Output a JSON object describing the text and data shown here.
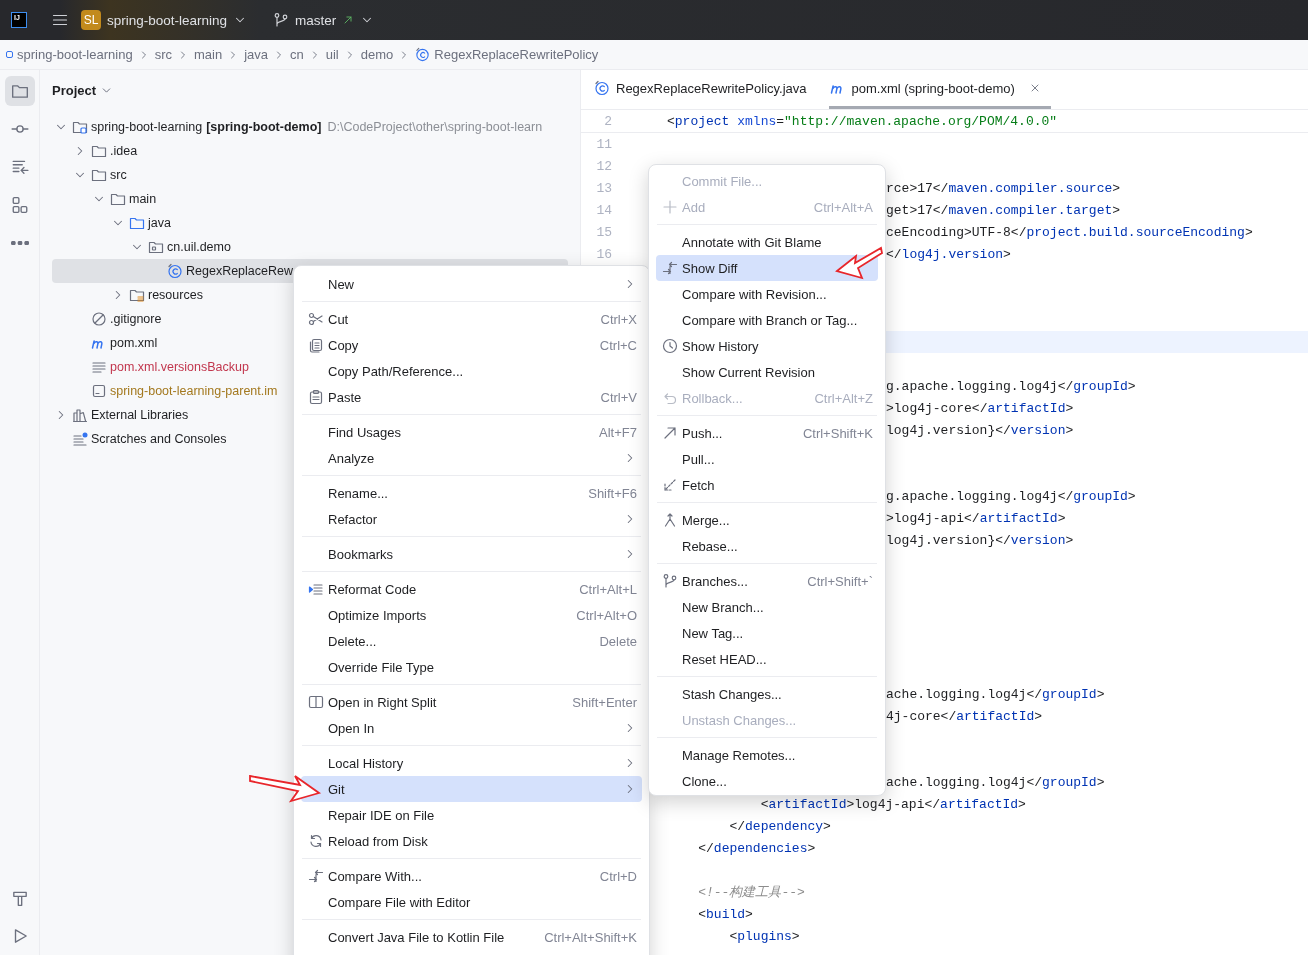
{
  "title_bar": {
    "logo": "IJ",
    "project_badge": "SL",
    "project": "spring-boot-learning",
    "branch": "master"
  },
  "breadcrumbs": [
    {
      "label": "spring-boot-learning",
      "kind": "module"
    },
    {
      "label": "src"
    },
    {
      "label": "main"
    },
    {
      "label": "java"
    },
    {
      "label": "cn"
    },
    {
      "label": "uil"
    },
    {
      "label": "demo"
    },
    {
      "label": "RegexReplaceRewritePolicy",
      "kind": "class"
    }
  ],
  "tool_strip": [
    {
      "kind": "folder",
      "selected": true
    },
    {
      "kind": "commit",
      "selected": false
    },
    {
      "kind": "pull",
      "selected": false
    },
    {
      "kind": "structure",
      "selected": false
    },
    {
      "kind": "more",
      "selected": false
    }
  ],
  "tool_strip_bottom": [
    {
      "kind": "build",
      "selected": false
    },
    {
      "kind": "run",
      "selected": false
    }
  ],
  "project_panel": {
    "title": "Project",
    "tree": [
      {
        "label": "spring-boot-learning",
        "module": "[spring-boot-demo]",
        "path": "D:\\CodeProject\\other\\spring-boot-learn",
        "kind": "module",
        "expanded": true,
        "selected": false,
        "children": [
          {
            "label": ".idea",
            "kind": "folder",
            "expanded": false,
            "selected": false
          },
          {
            "label": "src",
            "kind": "folder",
            "expanded": true,
            "selected": false,
            "children": [
              {
                "label": "main",
                "kind": "folder",
                "expanded": true,
                "selected": false,
                "children": [
                  {
                    "label": "java",
                    "kind": "source",
                    "expanded": true,
                    "selected": false,
                    "children": [
                      {
                        "label": "cn.uil.demo",
                        "kind": "package",
                        "expanded": true,
                        "selected": false,
                        "children": [
                          {
                            "label": "RegexReplaceRew",
                            "kind": "class",
                            "selected": true
                          }
                        ]
                      }
                    ]
                  },
                  {
                    "label": "resources",
                    "kind": "resources",
                    "expanded": false,
                    "selected": false
                  }
                ]
              }
            ]
          },
          {
            "label": ".gitignore",
            "kind": "gitignore",
            "selected": false
          },
          {
            "label": "pom.xml",
            "kind": "maven",
            "selected": false
          },
          {
            "label": "pom.xml.versionsBackup",
            "kind": "text",
            "color": "#c2374e",
            "selected": false
          },
          {
            "label": "spring-boot-learning-parent.im",
            "kind": "iml",
            "color": "#a3781e",
            "selected": false
          }
        ]
      },
      {
        "label": "External Libraries",
        "kind": "libraries",
        "expanded": false,
        "selected": false
      },
      {
        "label": "Scratches and Consoles",
        "kind": "scratches",
        "selected": false
      }
    ]
  },
  "editor": {
    "tabs": [
      {
        "label": "RegexReplaceRewritePolicy.java",
        "kind": "class",
        "selected": false,
        "closable": false
      },
      {
        "label": "pom.xml (spring-boot-demo)",
        "kind": "maven",
        "selected": true,
        "closable": true
      }
    ],
    "sticky_line": {
      "number": "2",
      "text": "<project xmlns=\"http://maven.apache.org/POM/4.0.0\""
    },
    "lines": [
      {
        "number": "11",
        "kind": "blank",
        "current": false
      },
      {
        "number": "12",
        "kind": "blank",
        "current": false
      },
      {
        "number": "13",
        "kind": "tail",
        "text": "rce>17</maven.compiler.source>",
        "current": false
      },
      {
        "number": "14",
        "kind": "tail",
        "text": "get>17</maven.compiler.target>",
        "current": false
      },
      {
        "number": "15",
        "kind": "tail",
        "text": "ceEncoding>UTF-8</project.build.sourceEncoding>",
        "current": false
      },
      {
        "number": "16",
        "kind": "tail",
        "text": "</log4j.version>",
        "current": false
      },
      {
        "kind": "blank",
        "current": false
      },
      {
        "kind": "blank",
        "current": false
      },
      {
        "kind": "blank",
        "current": false
      },
      {
        "kind": "blank",
        "current": true
      },
      {
        "kind": "blank",
        "current": false
      },
      {
        "kind": "tail",
        "text": "g.apache.logging.log4j</groupId>",
        "current": false
      },
      {
        "kind": "tail",
        "text": ">log4j-core</artifactId>",
        "current": false
      },
      {
        "kind": "tail",
        "text": "log4j.version}</version>",
        "current": false
      },
      {
        "kind": "blank",
        "current": false
      },
      {
        "kind": "blank",
        "current": false
      },
      {
        "kind": "tail",
        "text": "g.apache.logging.log4j</groupId>",
        "current": false
      },
      {
        "kind": "tail",
        "text": ">log4j-api</artifactId>",
        "current": false
      },
      {
        "kind": "tail",
        "text": "log4j.version}</version>",
        "current": false
      },
      {
        "kind": "blank",
        "current": false
      },
      {
        "kind": "blank",
        "current": false
      },
      {
        "kind": "blank",
        "current": false
      },
      {
        "kind": "blank",
        "current": false
      },
      {
        "kind": "blank",
        "current": false
      },
      {
        "kind": "blank",
        "current": false
      },
      {
        "kind": "tail",
        "text": "ache.logging.log4j</groupId>",
        "current": false
      },
      {
        "kind": "tail",
        "text": "4j-core</artifactId>",
        "current": false
      },
      {
        "kind": "blank",
        "current": false
      },
      {
        "kind": "blank",
        "current": false
      },
      {
        "kind": "tail",
        "text": "ache.logging.log4j</groupId>",
        "current": false
      },
      {
        "kind": "code",
        "text": "            <artifactId>log4j-api</artifactId>",
        "current": false
      },
      {
        "kind": "code",
        "text": "        </dependency>",
        "current": false
      },
      {
        "kind": "code",
        "text": "    </dependencies>",
        "current": false
      },
      {
        "kind": "blank",
        "current": false
      },
      {
        "kind": "comment",
        "text": "    <!--构建工具-->",
        "current": false
      },
      {
        "kind": "code",
        "text": "    <build>",
        "current": false
      },
      {
        "kind": "code",
        "text": "        <plugins>",
        "current": false
      }
    ]
  },
  "context_menu": {
    "groups": [
      [
        {
          "label": "New",
          "submenu": true,
          "selected": false
        }
      ],
      [
        {
          "label": "Cut",
          "shortcut": "Ctrl+X",
          "kind": "scissors",
          "selected": false
        },
        {
          "label": "Copy",
          "shortcut": "Ctrl+C",
          "kind": "copy",
          "selected": false
        },
        {
          "label": "Copy Path/Reference...",
          "selected": false
        },
        {
          "label": "Paste",
          "shortcut": "Ctrl+V",
          "kind": "paste",
          "selected": false
        }
      ],
      [
        {
          "label": "Find Usages",
          "shortcut": "Alt+F7",
          "selected": false
        },
        {
          "label": "Analyze",
          "submenu": true,
          "selected": false
        }
      ],
      [
        {
          "label": "Rename...",
          "shortcut": "Shift+F6",
          "selected": false
        },
        {
          "label": "Refactor",
          "submenu": true,
          "selected": false
        }
      ],
      [
        {
          "label": "Bookmarks",
          "submenu": true,
          "selected": false
        }
      ],
      [
        {
          "label": "Reformat Code",
          "shortcut": "Ctrl+Alt+L",
          "kind": "reformat",
          "selected": false
        },
        {
          "label": "Optimize Imports",
          "shortcut": "Ctrl+Alt+O",
          "selected": false
        },
        {
          "label": "Delete...",
          "shortcut": "Delete",
          "selected": false
        },
        {
          "label": "Override File Type",
          "selected": false
        }
      ],
      [
        {
          "label": "Open in Right Split",
          "shortcut": "Shift+Enter",
          "kind": "split",
          "selected": false
        },
        {
          "label": "Open In",
          "submenu": true,
          "selected": false
        }
      ],
      [
        {
          "label": "Local History",
          "submenu": true,
          "selected": false
        },
        {
          "label": "Git",
          "submenu": true,
          "selected": true
        },
        {
          "label": "Repair IDE on File",
          "selected": false
        },
        {
          "label": "Reload from Disk",
          "kind": "reload",
          "selected": false
        }
      ],
      [
        {
          "label": "Compare With...",
          "shortcut": "Ctrl+D",
          "kind": "compare",
          "selected": false
        },
        {
          "label": "Compare File with Editor",
          "selected": false
        }
      ],
      [
        {
          "label": "Convert Java File to Kotlin File",
          "shortcut": "Ctrl+Alt+Shift+K",
          "selected": false
        }
      ]
    ]
  },
  "git_menu": {
    "groups": [
      [
        {
          "label": "Commit File...",
          "disabled": true,
          "selected": false
        },
        {
          "label": "Add",
          "shortcut": "Ctrl+Alt+A",
          "kind": "plus",
          "disabled": true,
          "selected": false
        }
      ],
      [
        {
          "label": "Annotate with Git Blame",
          "disabled": false,
          "selected": false
        },
        {
          "label": "Show Diff",
          "kind": "compare",
          "disabled": false,
          "selected": true
        },
        {
          "label": "Compare with Revision...",
          "disabled": false,
          "selected": false
        },
        {
          "label": "Compare with Branch or Tag...",
          "disabled": false,
          "selected": false
        },
        {
          "label": "Show History",
          "kind": "clock",
          "disabled": false,
          "selected": false
        },
        {
          "label": "Show Current Revision",
          "disabled": false,
          "selected": false
        },
        {
          "label": "Rollback...",
          "shortcut": "Ctrl+Alt+Z",
          "kind": "rollback",
          "disabled": true,
          "selected": false
        }
      ],
      [
        {
          "label": "Push...",
          "shortcut": "Ctrl+Shift+K",
          "kind": "push",
          "disabled": false,
          "selected": false
        },
        {
          "label": "Pull...",
          "disabled": false,
          "selected": false
        },
        {
          "label": "Fetch",
          "kind": "fetch",
          "disabled": false,
          "selected": false
        }
      ],
      [
        {
          "label": "Merge...",
          "kind": "merge",
          "disabled": false,
          "selected": false
        },
        {
          "label": "Rebase...",
          "disabled": false,
          "selected": false
        }
      ],
      [
        {
          "label": "Branches...",
          "shortcut": "Ctrl+Shift+`",
          "kind": "branch",
          "disabled": false,
          "selected": false
        },
        {
          "label": "New Branch...",
          "disabled": false,
          "selected": false
        },
        {
          "label": "New Tag...",
          "disabled": false,
          "selected": false
        },
        {
          "label": "Reset HEAD...",
          "disabled": false,
          "selected": false
        }
      ],
      [
        {
          "label": "Stash Changes...",
          "disabled": false,
          "selected": false
        },
        {
          "label": "Unstash Changes...",
          "disabled": true,
          "selected": false
        }
      ],
      [
        {
          "label": "Manage Remotes...",
          "disabled": false,
          "selected": false
        },
        {
          "label": "Clone...",
          "disabled": false,
          "selected": false
        }
      ]
    ]
  }
}
